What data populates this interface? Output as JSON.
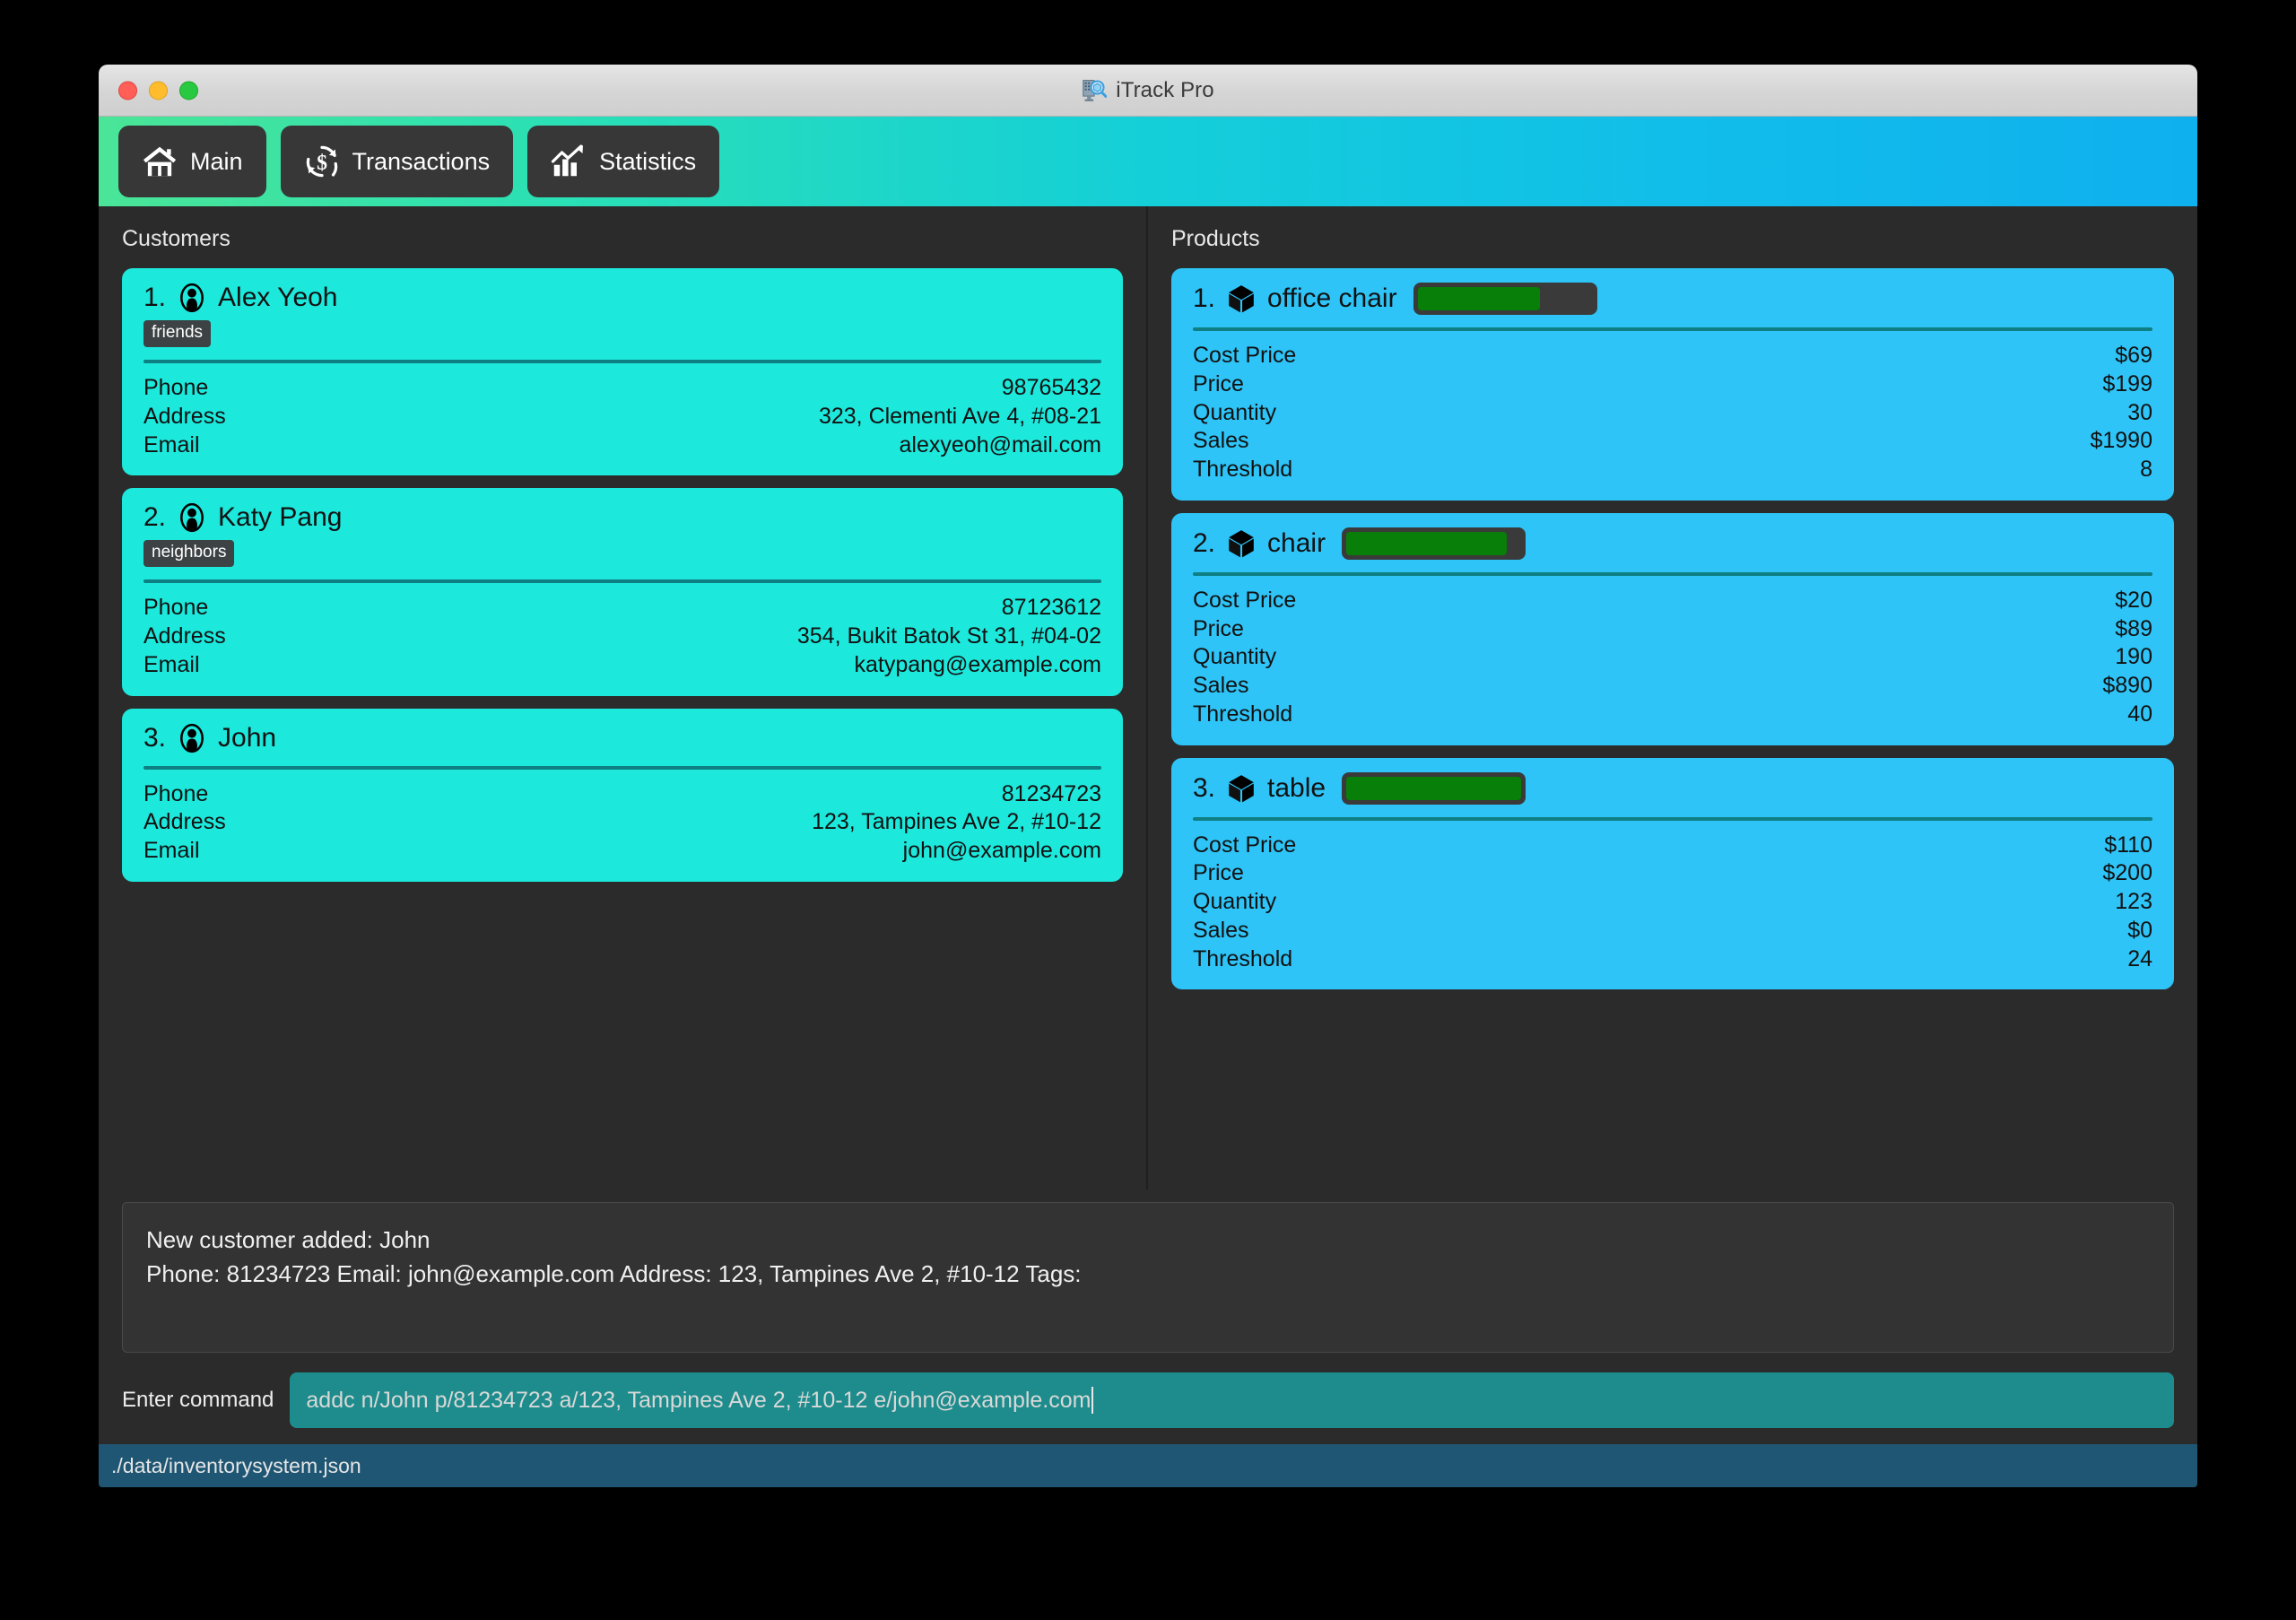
{
  "window": {
    "title": "iTrack Pro",
    "title_icon": "inventory-search-icon",
    "traffic_lights": [
      "close",
      "minimize",
      "maximize"
    ]
  },
  "toolbar": {
    "gradient_from": "#4ae597",
    "gradient_to": "#0fb0ee",
    "buttons": [
      {
        "label": "Main",
        "icon": "home-icon"
      },
      {
        "label": "Transactions",
        "icon": "dollar-refresh-icon"
      },
      {
        "label": "Statistics",
        "icon": "bar-chart-arrow-icon"
      }
    ]
  },
  "customers_panel": {
    "title": "Customers",
    "card_color": "#1ce8dc",
    "field_labels": {
      "phone": "Phone",
      "address": "Address",
      "email": "Email"
    },
    "items": [
      {
        "index": "1.",
        "name": "Alex Yeoh",
        "icon": "person-icon",
        "tags": [
          "friends"
        ],
        "phone": "98765432",
        "address": "323, Clementi Ave 4, #08-21",
        "email": "alexyeoh@mail.com"
      },
      {
        "index": "2.",
        "name": "Katy Pang",
        "icon": "person-icon",
        "tags": [
          "neighbors"
        ],
        "phone": "87123612",
        "address": "354, Bukit Batok St 31, #04-02",
        "email": "katypang@example.com"
      },
      {
        "index": "3.",
        "name": "John",
        "icon": "person-icon",
        "tags": [],
        "phone": "81234723",
        "address": "123, Tampines Ave 2, #10-12",
        "email": "john@example.com"
      }
    ]
  },
  "products_panel": {
    "title": "Products",
    "card_color": "#2ec4f7",
    "bar_fill_color": "#087f08",
    "bar_track_color": "#3a3a3a",
    "field_labels": {
      "cost_price": "Cost Price",
      "price": "Price",
      "quantity": "Quantity",
      "sales": "Sales",
      "threshold": "Threshold"
    },
    "items": [
      {
        "index": "1.",
        "name": "office chair",
        "icon": "box-icon",
        "stock_percent": 70,
        "cost_price": "$69",
        "price": "$199",
        "quantity": "30",
        "sales": "$1990",
        "threshold": "8"
      },
      {
        "index": "2.",
        "name": "chair",
        "icon": "box-icon",
        "stock_percent": 92,
        "cost_price": "$20",
        "price": "$89",
        "quantity": "190",
        "sales": "$890",
        "threshold": "40"
      },
      {
        "index": "3.",
        "name": "table",
        "icon": "box-icon",
        "stock_percent": 100,
        "cost_price": "$110",
        "price": "$200",
        "quantity": "123",
        "sales": "$0",
        "threshold": "24"
      }
    ]
  },
  "result_box": {
    "line1": "New customer added: John",
    "line2": "Phone: 81234723 Email: john@example.com Address: 123, Tampines Ave 2, #10-12 Tags:"
  },
  "command_bar": {
    "label": "Enter command",
    "value": "addc n/John p/81234723 a/123, Tampines Ave 2, #10-12 e/john@example.com",
    "placeholder": "Enter command"
  },
  "status_bar": {
    "path": "./data/inventorysystem.json"
  }
}
